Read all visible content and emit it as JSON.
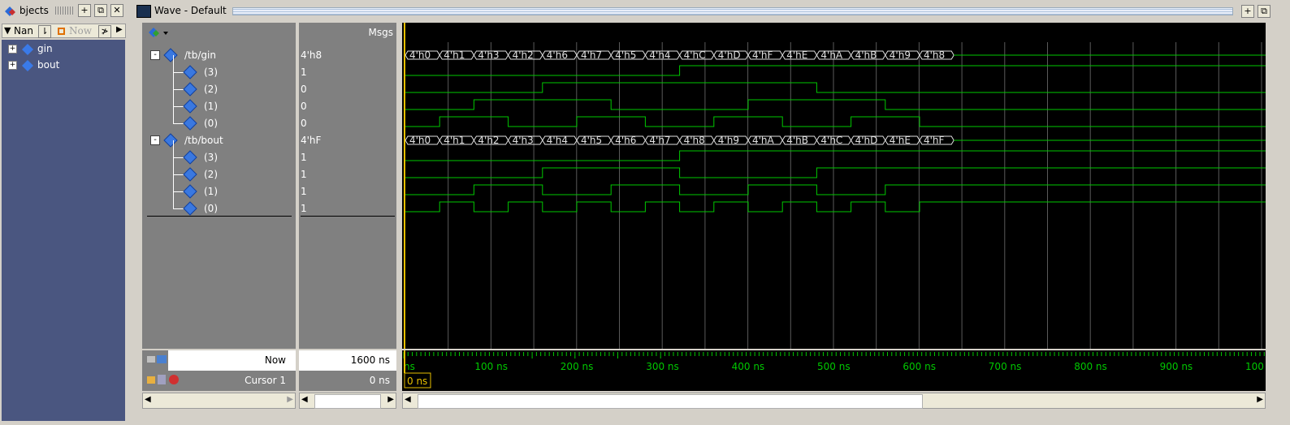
{
  "objects": {
    "title": "bjects",
    "header": {
      "name_label": "Nan",
      "now_label": "Now"
    },
    "items": [
      {
        "label": "gin"
      },
      {
        "label": "bout"
      }
    ]
  },
  "wave": {
    "title": "Wave - Default",
    "msgs_label": "Msgs",
    "signals": [
      {
        "name": "/tb/gin",
        "value": "4'h8",
        "expand": "-"
      },
      {
        "name": "(3)",
        "value": "1"
      },
      {
        "name": "(2)",
        "value": "0"
      },
      {
        "name": "(1)",
        "value": "0"
      },
      {
        "name": "(0)",
        "value": "0"
      },
      {
        "name": "/tb/bout",
        "value": "4'hF",
        "expand": "-"
      },
      {
        "name": "(3)",
        "value": "1"
      },
      {
        "name": "(2)",
        "value": "1"
      },
      {
        "name": "(1)",
        "value": "1"
      },
      {
        "name": "(0)",
        "value": "1"
      }
    ],
    "gin_bus_labels": [
      "4'h0",
      "4'h1",
      "4'h3",
      "4'h2",
      "4'h6",
      "4'h7",
      "4'h5",
      "4'h4",
      "4'hC",
      "4'hD",
      "4'hF",
      "4'hE",
      "4'hA",
      "4'hB",
      "4'h9",
      "4'h8"
    ],
    "bout_bus_labels": [
      "4'h0",
      "4'h1",
      "4'h2",
      "4'h3",
      "4'h4",
      "4'h5",
      "4'h6",
      "4'h7",
      "4'h8",
      "4'h9",
      "4'hA",
      "4'hB",
      "4'hC",
      "4'hD",
      "4'hE",
      "4'hF"
    ],
    "now_label": "Now",
    "now_value": "1600 ns",
    "cursor_label": "Cursor 1",
    "cursor_value": "0 ns",
    "cursor_marker": "0 ns",
    "time_labels": [
      "ns",
      "100 ns",
      "200 ns",
      "300 ns",
      "400 ns",
      "500 ns",
      "600 ns",
      "700 ns",
      "800 ns",
      "900 ns",
      "100"
    ]
  },
  "colors": {
    "wave": "#00c800",
    "grid": "#5a5a5a",
    "cursor": "#e8c000",
    "bus": "#e0e0e0",
    "panel": "#808080"
  }
}
